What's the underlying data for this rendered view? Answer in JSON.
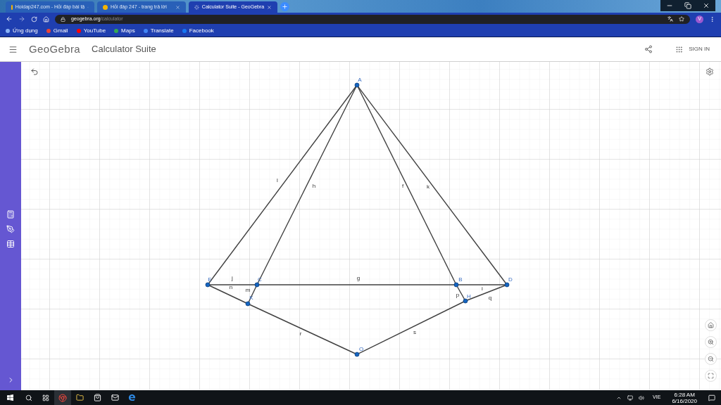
{
  "browser": {
    "tabs": [
      {
        "title": "Hoidap247.com - Hỏi đáp bài tậ",
        "selected": false
      },
      {
        "title": "Hỏi đáp 247 - trang trả lời",
        "selected": false
      },
      {
        "title": "Calculator Suite - GeoGebra",
        "selected": true
      }
    ],
    "url": {
      "host": "geogebra.org",
      "path": "/calculator"
    },
    "profile": "V",
    "bookmarks": [
      {
        "label": "Ứng dụng",
        "kind": "apps"
      },
      {
        "label": "Gmail",
        "kind": "gmail"
      },
      {
        "label": "YouTube",
        "kind": "youtube"
      },
      {
        "label": "Maps",
        "kind": "maps"
      },
      {
        "label": "Translate",
        "kind": "translate"
      },
      {
        "label": "Facebook",
        "kind": "facebook"
      }
    ]
  },
  "app": {
    "logo": "GeoGebra",
    "title": "Calculator Suite",
    "sign_in": "SIGN IN"
  },
  "graph": {
    "points": [
      {
        "label": "A"
      },
      {
        "label": "E"
      },
      {
        "label": "C"
      },
      {
        "label": "B"
      },
      {
        "label": "D"
      },
      {
        "label": "K"
      },
      {
        "label": "H"
      },
      {
        "label": "O"
      }
    ],
    "segments": [
      {
        "label": "l"
      },
      {
        "label": "h"
      },
      {
        "label": "f"
      },
      {
        "label": "k"
      },
      {
        "label": "j"
      },
      {
        "label": "g"
      },
      {
        "label": "n"
      },
      {
        "label": "m"
      },
      {
        "label": "i"
      },
      {
        "label": "p"
      },
      {
        "label": "q"
      },
      {
        "label": "r"
      },
      {
        "label": "s"
      }
    ]
  },
  "taskbar": {
    "language": "VIE",
    "time": "6:28 AM",
    "date": "6/16/2020"
  }
}
